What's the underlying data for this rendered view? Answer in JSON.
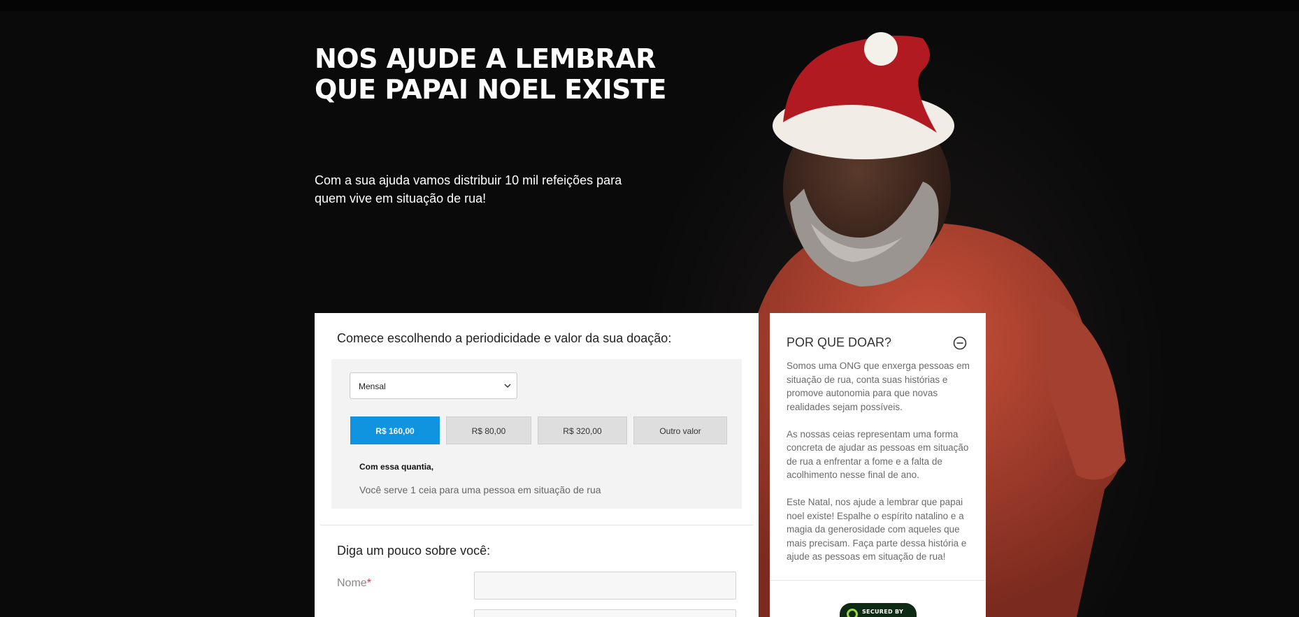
{
  "hero": {
    "headline_line1": "NOS AJUDE A LEMBRAR",
    "headline_line2": "QUE PAPAI NOEL EXISTE",
    "subline": "Com a sua ajuda vamos distribuir 10 mil refeições para quem vive em situação de rua!"
  },
  "donation": {
    "title": "Comece escolhendo a periodicidade e valor da sua doação:",
    "frequency_selected": "Mensal",
    "amounts": [
      {
        "label": "R$ 160,00",
        "selected": true
      },
      {
        "label": "R$ 80,00",
        "selected": false
      },
      {
        "label": "R$ 320,00",
        "selected": false
      },
      {
        "label": "Outro valor",
        "selected": false
      }
    ],
    "impact_label": "Com essa quantia,",
    "impact_text": "Você serve 1 ceia para uma pessoa em situação de rua",
    "accent_color": "#1194e0"
  },
  "about": {
    "title": "Diga um pouco sobre você:",
    "name_label": "Nome",
    "required_mark": "*"
  },
  "why": {
    "title": "POR QUE DOAR?",
    "toggle_icon": "minus-circle-icon",
    "paragraphs": [
      "Somos uma ONG que enxerga pessoas em situação de rua, conta suas histórias e promove autonomia para que novas realidades sejam possíveis.",
      "As nossas ceias representam uma forma concreta de ajudar as pessoas em situação de rua a enfrentar a fome e a falta de acolhimento nesse final de ano.",
      "Este Natal, nos ajude a lembrar que papai noel existe! Espalhe o espírito natalino e a magia da generosidade com aqueles que mais precisam. Faça parte dessa história e ajude as pessoas em situação de rua!"
    ],
    "badge_text": "SECURED BY"
  }
}
